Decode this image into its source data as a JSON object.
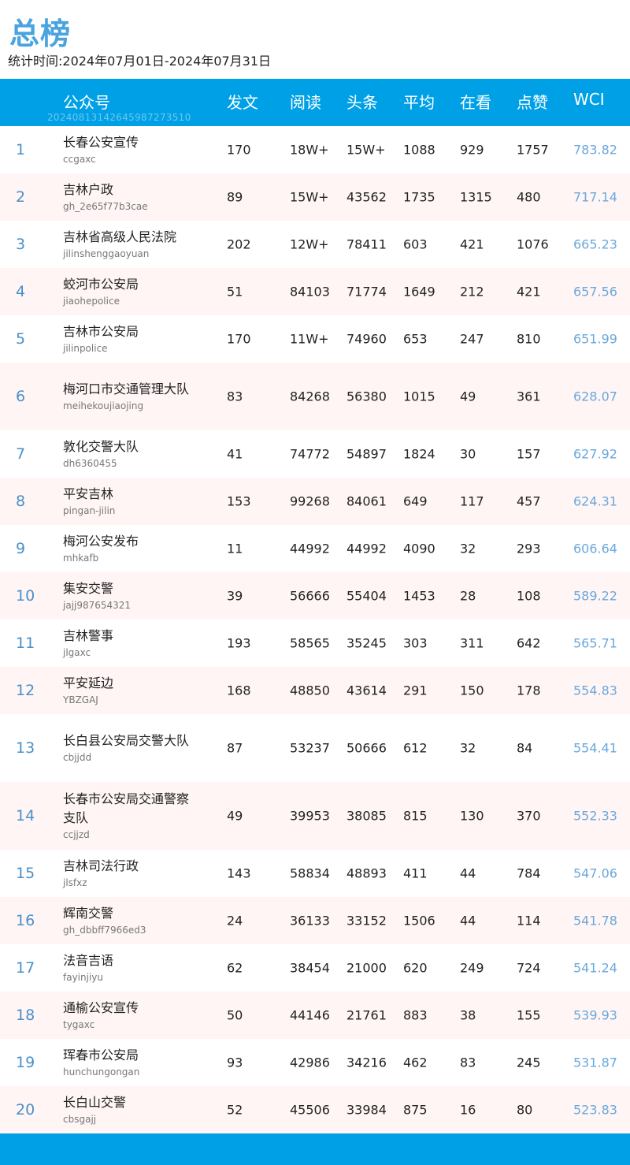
{
  "page": {
    "title": "总榜",
    "period": "统计时间:2024年07月01日-2024年07月31日"
  },
  "header": {
    "account": "公众号",
    "posts": "发文",
    "reads": "阅读",
    "headline": "头条",
    "average": "平均",
    "looking": "在看",
    "likes": "点赞",
    "wci": "WCI",
    "code": "20240813142645987273510"
  },
  "rows": [
    {
      "rank": "1",
      "name": "长春公安宣传",
      "account": "ccgaxc",
      "posts": "170",
      "reads": "18W+",
      "headline": "15W+",
      "average": "1088",
      "looking": "929",
      "likes": "1757",
      "wci": "783.82"
    },
    {
      "rank": "2",
      "name": "吉林户政",
      "account": "gh_2e65f77b3cae",
      "posts": "89",
      "reads": "15W+",
      "headline": "43562",
      "average": "1735",
      "looking": "1315",
      "likes": "480",
      "wci": "717.14"
    },
    {
      "rank": "3",
      "name": "吉林省高级人民法院",
      "account": "jilinshenggaoyuan",
      "posts": "202",
      "reads": "12W+",
      "headline": "78411",
      "average": "603",
      "looking": "421",
      "likes": "1076",
      "wci": "665.23"
    },
    {
      "rank": "4",
      "name": "蛟河市公安局",
      "account": "jiaohepolice",
      "posts": "51",
      "reads": "84103",
      "headline": "71774",
      "average": "1649",
      "looking": "212",
      "likes": "421",
      "wci": "657.56"
    },
    {
      "rank": "5",
      "name": "吉林市公安局",
      "account": "jilinpolice",
      "posts": "170",
      "reads": "11W+",
      "headline": "74960",
      "average": "653",
      "looking": "247",
      "likes": "810",
      "wci": "651.99"
    },
    {
      "rank": "6",
      "name": "梅河口市交通管理大队",
      "account": "meihekoujiaojing",
      "posts": "83",
      "reads": "84268",
      "headline": "56380",
      "average": "1015",
      "looking": "49",
      "likes": "361",
      "wci": "628.07"
    },
    {
      "rank": "7",
      "name": "敦化交警大队",
      "account": "dh6360455",
      "posts": "41",
      "reads": "74772",
      "headline": "54897",
      "average": "1824",
      "looking": "30",
      "likes": "157",
      "wci": "627.92"
    },
    {
      "rank": "8",
      "name": "平安吉林",
      "account": "pingan-jilin",
      "posts": "153",
      "reads": "99268",
      "headline": "84061",
      "average": "649",
      "looking": "117",
      "likes": "457",
      "wci": "624.31"
    },
    {
      "rank": "9",
      "name": "梅河公安发布",
      "account": "mhkafb",
      "posts": "11",
      "reads": "44992",
      "headline": "44992",
      "average": "4090",
      "looking": "32",
      "likes": "293",
      "wci": "606.64"
    },
    {
      "rank": "10",
      "name": "集安交警",
      "account": "jajj987654321",
      "posts": "39",
      "reads": "56666",
      "headline": "55404",
      "average": "1453",
      "looking": "28",
      "likes": "108",
      "wci": "589.22"
    },
    {
      "rank": "11",
      "name": "吉林警事",
      "account": "jlgaxc",
      "posts": "193",
      "reads": "58565",
      "headline": "35245",
      "average": "303",
      "looking": "311",
      "likes": "642",
      "wci": "565.71"
    },
    {
      "rank": "12",
      "name": "平安延边",
      "account": "YBZGAJ",
      "posts": "168",
      "reads": "48850",
      "headline": "43614",
      "average": "291",
      "looking": "150",
      "likes": "178",
      "wci": "554.83"
    },
    {
      "rank": "13",
      "name": "长白县公安局交警大队",
      "account": "cbjjdd",
      "posts": "87",
      "reads": "53237",
      "headline": "50666",
      "average": "612",
      "looking": "32",
      "likes": "84",
      "wci": "554.41"
    },
    {
      "rank": "14",
      "name": "长春市公安局交通警察支队",
      "account": "ccjjzd",
      "posts": "49",
      "reads": "39953",
      "headline": "38085",
      "average": "815",
      "looking": "130",
      "likes": "370",
      "wci": "552.33"
    },
    {
      "rank": "15",
      "name": "吉林司法行政",
      "account": "jlsfxz",
      "posts": "143",
      "reads": "58834",
      "headline": "48893",
      "average": "411",
      "looking": "44",
      "likes": "784",
      "wci": "547.06"
    },
    {
      "rank": "16",
      "name": "辉南交警",
      "account": "gh_dbbff7966ed3",
      "posts": "24",
      "reads": "36133",
      "headline": "33152",
      "average": "1506",
      "looking": "44",
      "likes": "114",
      "wci": "541.78"
    },
    {
      "rank": "17",
      "name": "法音吉语",
      "account": "fayinjiyu",
      "posts": "62",
      "reads": "38454",
      "headline": "21000",
      "average": "620",
      "looking": "249",
      "likes": "724",
      "wci": "541.24"
    },
    {
      "rank": "18",
      "name": "通榆公安宣传",
      "account": "tygaxc",
      "posts": "50",
      "reads": "44146",
      "headline": "21761",
      "average": "883",
      "looking": "38",
      "likes": "155",
      "wci": "539.93"
    },
    {
      "rank": "19",
      "name": "珲春市公安局",
      "account": "hunchungongan",
      "posts": "93",
      "reads": "42986",
      "headline": "34216",
      "average": "462",
      "looking": "83",
      "likes": "245",
      "wci": "531.87"
    },
    {
      "rank": "20",
      "name": "长白山交警",
      "account": "cbsgajj",
      "posts": "52",
      "reads": "45506",
      "headline": "33984",
      "average": "875",
      "looking": "16",
      "likes": "80",
      "wci": "523.83"
    }
  ]
}
